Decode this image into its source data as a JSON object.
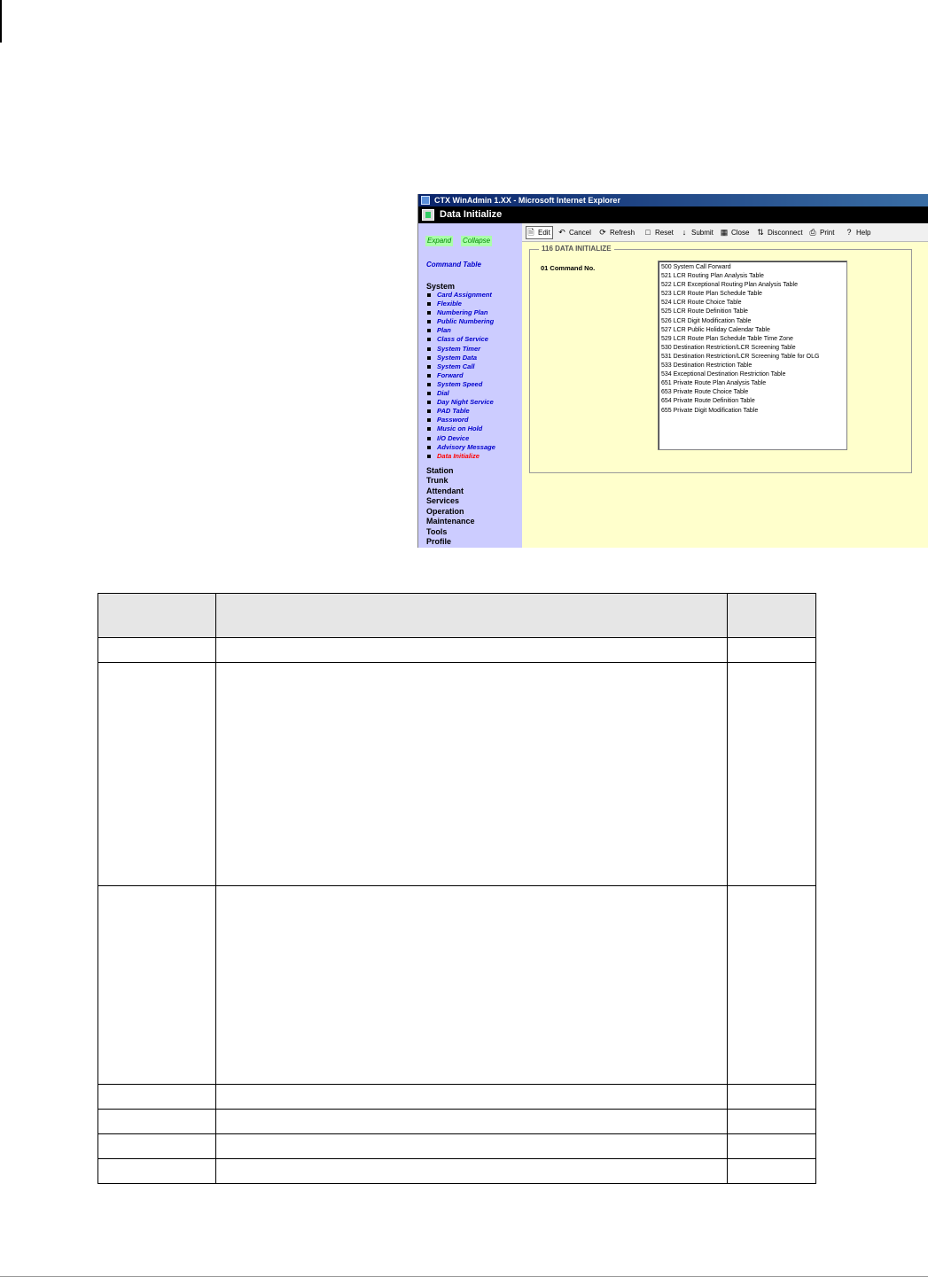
{
  "window": {
    "title": "CTX WinAdmin 1.XX - Microsoft Internet Explorer",
    "page_header": "Data Initialize"
  },
  "nav": {
    "expand_label": "Expand",
    "collapse_label": "Collapse",
    "command_table_label": "Command Table",
    "system_heading": "System",
    "system_items": [
      "Card Assignment",
      "Flexible",
      "Numbering Plan",
      "Public Numbering",
      "Plan",
      "Class of Service",
      "System Timer",
      "System Data",
      "System Call",
      "Forward",
      "System Speed",
      "Dial",
      "Day Night Service",
      "PAD Table",
      "Password",
      "Music on Hold",
      "I/O Device",
      "Advisory Message",
      "Data Initialize"
    ],
    "categories": [
      "Station",
      "Trunk",
      "Attendant",
      "Services",
      "Operation",
      "Maintenance",
      "Tools",
      "Profile"
    ]
  },
  "toolbar": {
    "edit": "Edit",
    "cancel": "Cancel",
    "refresh": "Refresh",
    "reset": "Reset",
    "submit": "Submit",
    "close": "Close",
    "disconnect": "Disconnect",
    "print": "Print",
    "help": "Help"
  },
  "form": {
    "legend": "116 DATA INITIALIZE",
    "field_label": "01 Command No.",
    "options": [
      "500 System Call Forward",
      "521 LCR Routing Plan Analysis Table",
      "522 LCR Exceptional Routing Plan Analysis Table",
      "523 LCR Route Plan Schedule Table",
      "524 LCR Route Choice Table",
      "525 LCR Route Definition Table",
      "526 LCR Digit Modification Table",
      "527 LCR Public Holiday Calendar Table",
      "529 LCR Route Plan Schedule Table Time Zone",
      "530 Destination Restriction/LCR Screening Table",
      "531 Destination Restriction/LCR Screening Table for OLG",
      "533 Destination Restriction Table",
      "534 Exceptional Destination Restriction Table",
      "651 Private Route Plan Analysis Table",
      "653 Private Route Choice Table",
      "654 Private Route Definition Table",
      "655 Private Digit Modification Table"
    ]
  }
}
